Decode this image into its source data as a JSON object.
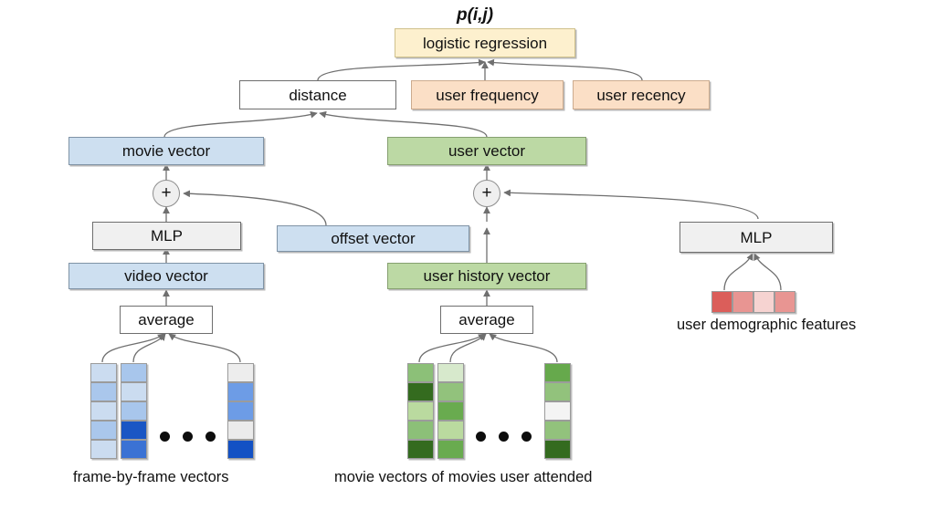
{
  "diagram": {
    "output_label": "p(i,j)",
    "nodes": {
      "logistic_regression": "logistic regression",
      "distance": "distance",
      "user_frequency": "user frequency",
      "user_recency": "user recency",
      "movie_vector": "movie vector",
      "user_vector": "user vector",
      "mlp_left": "MLP",
      "mlp_right": "MLP",
      "offset_vector": "offset vector",
      "video_vector": "video vector",
      "user_history_vector": "user history vector",
      "average_left": "average",
      "average_right": "average",
      "plus_left": "+",
      "plus_right": "+"
    },
    "captions": {
      "frame_vectors": "frame-by-frame vectors",
      "movie_vectors": "movie vectors of movies user attended",
      "demographics": "user demographic features"
    },
    "colors": {
      "yellow": "#fdf0ce",
      "peach": "#fbdfc6",
      "blue": "#cddff0",
      "green": "#bcd9a4",
      "grey": "#f0f0f0",
      "white": "#ffffff"
    },
    "heatmaps": {
      "frame_vectors": [
        [
          "#cbdcf0",
          "#aac7ec",
          "#cbdcf0",
          "#aac7ec",
          "#cbdcf0"
        ],
        [
          "#a8c6ec",
          "#cbdcf0",
          "#a8c6ec",
          "#1a56c4",
          "#3b72d4"
        ],
        [
          "#ededed",
          "#6d9ce6",
          "#6d9ce6",
          "#ebebeb",
          "#1351c4"
        ]
      ],
      "user_history_vectors": [
        [
          "#8cc078",
          "#346b1f",
          "#bada9f",
          "#8cc078",
          "#346b1f"
        ],
        [
          "#d7e9cc",
          "#92c27c",
          "#69ab4f",
          "#bada9f",
          "#69ab4f"
        ],
        [
          "#66a94c",
          "#92c27c",
          "#f4f4f4",
          "#92c27c",
          "#346b1f"
        ]
      ],
      "demographic_features": [
        "#db5e5a",
        "#e89592",
        "#f6d3d1",
        "#e89592"
      ]
    },
    "ellipsis": "• • •"
  }
}
